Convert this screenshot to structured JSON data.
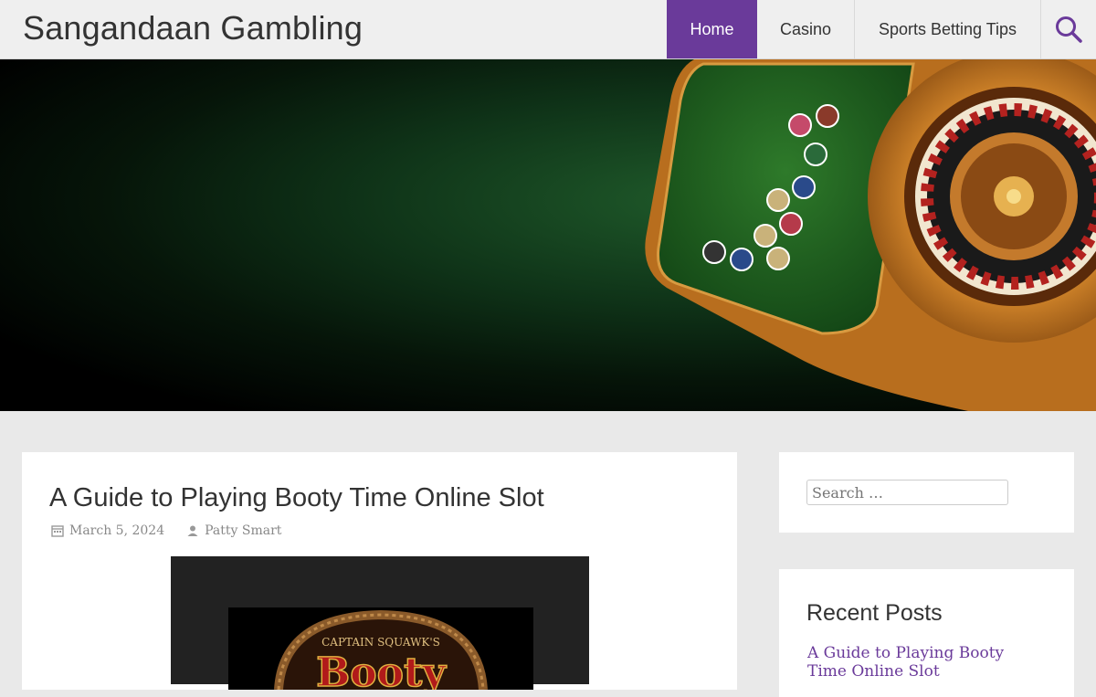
{
  "site": {
    "title": "Sangandaan Gambling"
  },
  "nav": {
    "items": [
      {
        "label": "Home",
        "active": true
      },
      {
        "label": "Casino",
        "active": false
      },
      {
        "label": "Sports Betting Tips",
        "active": false
      }
    ],
    "search_icon": "search-icon"
  },
  "post": {
    "title": "A Guide to Playing Booty Time Online Slot",
    "date": "March 5, 2024",
    "author": "Patty Smart",
    "image_text": {
      "top": "CAPTAIN SQUAWK'S",
      "main": "Booty"
    }
  },
  "sidebar": {
    "search_placeholder": "Search …",
    "recent_title": "Recent Posts",
    "recent_posts": [
      "A Guide to Playing Booty Time Online Slot"
    ]
  },
  "colors": {
    "accent": "#6a3a9a",
    "hero_green": "#1f5a2a"
  }
}
